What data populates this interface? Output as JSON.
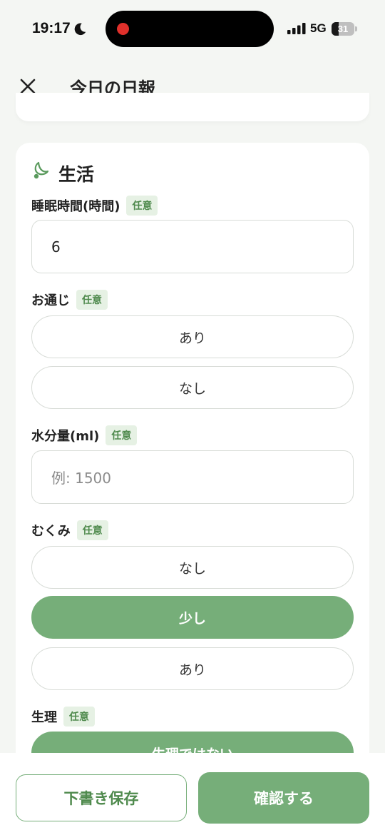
{
  "status_bar": {
    "time": "19:17",
    "network": "5G",
    "battery": "31",
    "battery_level": 0.31
  },
  "nav": {
    "title": "今日の日報"
  },
  "section": {
    "title": "生活",
    "icon": "moon-leaf-icon"
  },
  "fields": {
    "sleep": {
      "label": "睡眠時間(時間)",
      "badge": "任意",
      "value": "6"
    },
    "bowel": {
      "label": "お通じ",
      "badge": "任意",
      "options": [
        "あり",
        "なし"
      ],
      "selected": null
    },
    "water": {
      "label": "水分量(ml)",
      "badge": "任意",
      "placeholder": "例: 1500"
    },
    "swelling": {
      "label": "むくみ",
      "badge": "任意",
      "options": [
        "なし",
        "少し",
        "あり"
      ],
      "selected": "少し"
    },
    "period": {
      "label": "生理",
      "badge": "任意",
      "options": [
        "生理ではない"
      ],
      "selected": "生理ではない"
    }
  },
  "bottom": {
    "draft_label": "下書き保存",
    "confirm_label": "確認する"
  },
  "colors": {
    "accent": "#76ae79",
    "badge_bg": "#e6f1e4",
    "badge_text": "#4f8a4d"
  }
}
